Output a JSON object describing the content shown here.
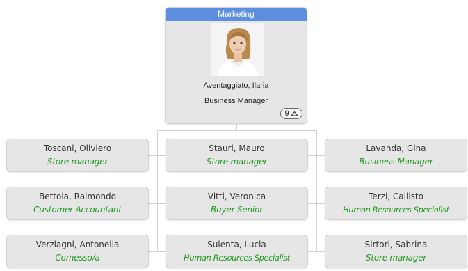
{
  "root": {
    "department": "Marketing",
    "name": "Aventaggiato, Ilaria",
    "role": "Business Manager",
    "children_count": "9"
  },
  "icons": {
    "photo": "portrait-photo",
    "toggle": "chevron-up-icon"
  },
  "colors": {
    "header": "#5c8fe0",
    "card": "#e6e6e6",
    "role_text": "#1f9a1f",
    "connector": "#d2d2d2"
  },
  "employees": [
    {
      "name": "Toscani, Oliviero",
      "role": "Store manager"
    },
    {
      "name": "Stauri, Mauro",
      "role": "Store manager"
    },
    {
      "name": "Lavanda, Gina",
      "role": "Business Manager"
    },
    {
      "name": "Bettola, Raimondo",
      "role": "Customer Accountant"
    },
    {
      "name": "Vitti, Veronica",
      "role": "Buyer Senior"
    },
    {
      "name": "Terzi, Callisto",
      "role": "Human Resources Specialist"
    },
    {
      "name": "Verziagni, Antonella",
      "role": "Comesso/a"
    },
    {
      "name": "Sulenta, Lucia",
      "role": "Human Resources Specialist"
    },
    {
      "name": "Sirtori, Sabrina",
      "role": "Store manager"
    }
  ]
}
